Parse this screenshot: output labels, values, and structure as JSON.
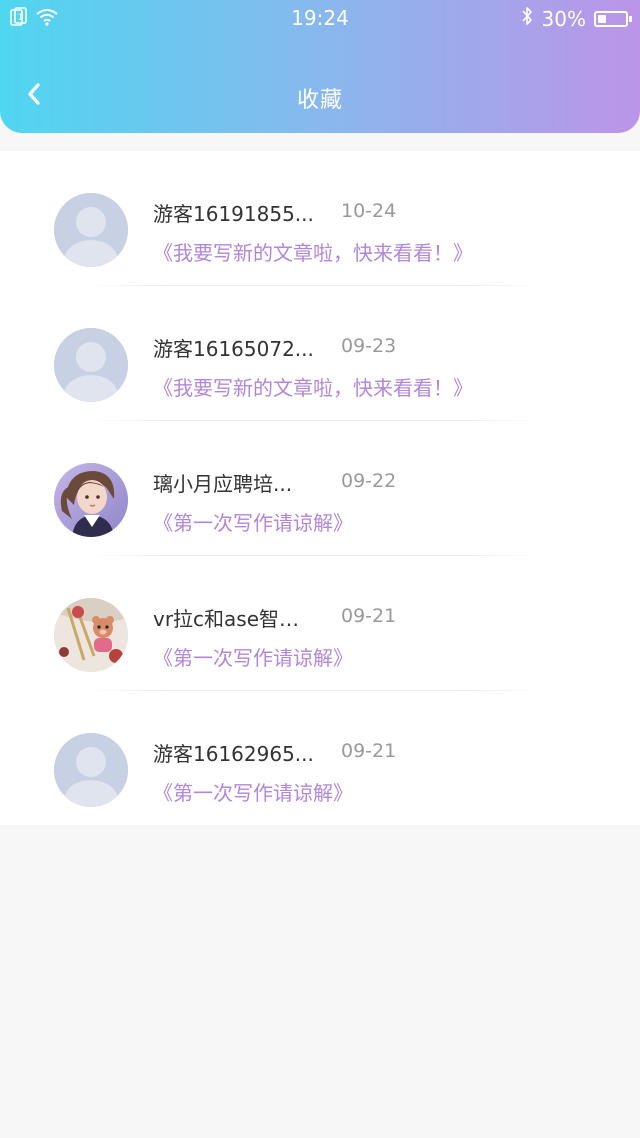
{
  "status_bar": {
    "time": "19:24",
    "battery_text": "30%",
    "battery_level": 0.3,
    "icons": [
      "sim-icon",
      "wifi-icon",
      "bluetooth-icon",
      "battery-icon"
    ]
  },
  "header": {
    "title": "收藏",
    "back_icon": "chevron-left-icon",
    "gradient_colors": [
      "#4fd6f0",
      "#88b8ee",
      "#bc95e8"
    ]
  },
  "accent_color": "#b187d8",
  "favorites": [
    {
      "name": "游客16191855...",
      "date": "10-24",
      "article": "《我要写新的文章啦，快来看看！》",
      "avatar": "default-avatar"
    },
    {
      "name": "游客16165072...",
      "date": "09-23",
      "article": "《我要写新的文章啦，快来看看！》",
      "avatar": "default-avatar"
    },
    {
      "name": "璃小月应聘培...",
      "date": "09-22",
      "article": "《第一次写作请谅解》",
      "avatar": "illustrated-girl-avatar"
    },
    {
      "name": "vr拉c和ase智能...",
      "date": "09-21",
      "article": "《第一次写作请谅解》",
      "avatar": "paperclip-bear-avatar"
    },
    {
      "name": "游客16162965...",
      "date": "09-21",
      "article": "《第一次写作请谅解》",
      "avatar": "default-avatar"
    }
  ]
}
